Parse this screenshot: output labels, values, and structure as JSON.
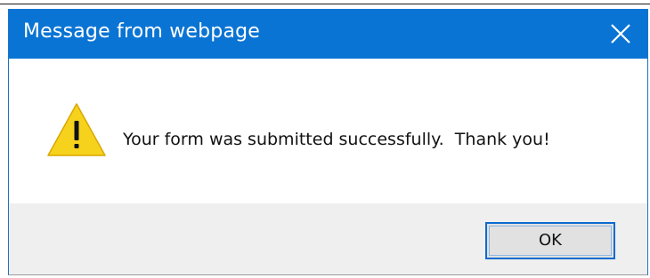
{
  "dialog": {
    "title": "Message from webpage",
    "message": "Your form was submitted successfully.  Thank you!",
    "ok_label": "OK",
    "icon": "warning-icon",
    "close_icon": "close-icon"
  },
  "colors": {
    "titlebar": "#0a74d4",
    "footer": "#efefef",
    "button_border": "#0a6ccf",
    "warning_fill": "#f7d21c"
  }
}
